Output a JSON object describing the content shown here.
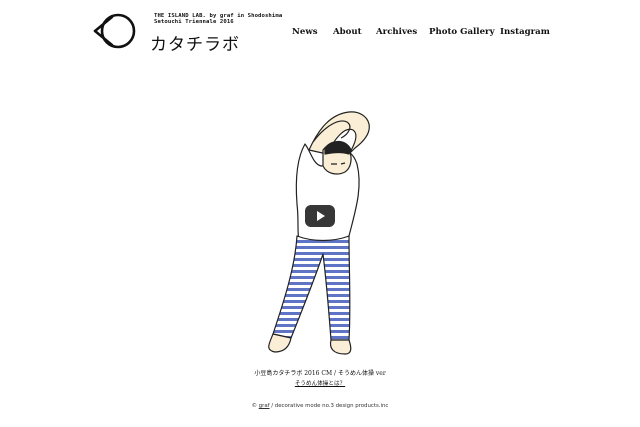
{
  "header": {
    "subtitle_line1": "THE ISLAND LAB. by graf in Shodoshima",
    "subtitle_line2": "Setouchi Triennale 2016",
    "logo_text": "カタチラボ"
  },
  "nav": {
    "news": "News",
    "about": "About",
    "archives": "Archives",
    "photo_gallery": "Photo Gallery",
    "instagram": "Instagram"
  },
  "video": {
    "caption": "小豆島カタチラボ 2016 CM / そうめん体操 ver",
    "link_text": "そうめん体操とは？"
  },
  "footer": {
    "copyright_symbol": "©",
    "graf": "graf",
    "rest": " / decorative mode no.3 design products.inc"
  },
  "colors": {
    "stripe_blue": "#5f74c4",
    "skin": "#fbeed6",
    "play_button": "#222222"
  }
}
